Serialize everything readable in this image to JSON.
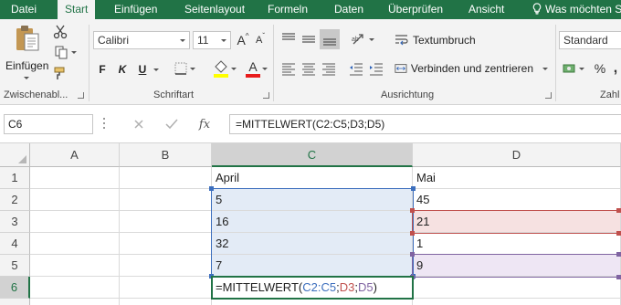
{
  "colors": {
    "excel_green": "#217346",
    "range_blue": "#3c6ebd",
    "range_red": "#c0504d",
    "range_purple": "#8064a2"
  },
  "tabs": {
    "datei": "Datei",
    "start": "Start",
    "einfuegen": "Einfügen",
    "seitenlayout": "Seitenlayout",
    "formeln": "Formeln",
    "daten": "Daten",
    "ueberpruefen": "Überprüfen",
    "ansicht": "Ansicht",
    "tell_me": "Was möchten S"
  },
  "ribbon": {
    "clipboard": {
      "paste_label": "Einfügen",
      "group_label": "Zwischenabl..."
    },
    "font": {
      "font_name": "Calibri",
      "font_size": "11",
      "bold": "F",
      "italic": "K",
      "underline": "U",
      "group_label": "Schriftart",
      "grow_label": "A",
      "shrink_label": "A",
      "color_label": "A"
    },
    "alignment": {
      "wrap_text": "Textumbruch",
      "merge_center": "Verbinden und zentrieren",
      "group_label": "Ausrichtung"
    },
    "number": {
      "format": "Standard",
      "percent": "%",
      "group_label": "Zahl"
    }
  },
  "formula_bar": {
    "name_box": "C6",
    "fx_label": "fx",
    "formula": "=MITTELWERT(C2:C5;D3;D5)"
  },
  "grid": {
    "columns": [
      "A",
      "B",
      "C",
      "D"
    ],
    "rows": [
      "1",
      "2",
      "3",
      "4",
      "5",
      "6"
    ],
    "cells": {
      "C1": "April",
      "D1": "Mai",
      "C2": "5",
      "D2": "45",
      "C3": "16",
      "D3": "21",
      "C4": "32",
      "D4": "1",
      "C5": "7",
      "D5": "9"
    },
    "edit": {
      "prefix": "=MITTELWERT(",
      "ref1": "C2:C5",
      "sep1": ";",
      "ref2": "D3",
      "sep2": ";",
      "ref3": "D5",
      "suffix": ")"
    }
  }
}
